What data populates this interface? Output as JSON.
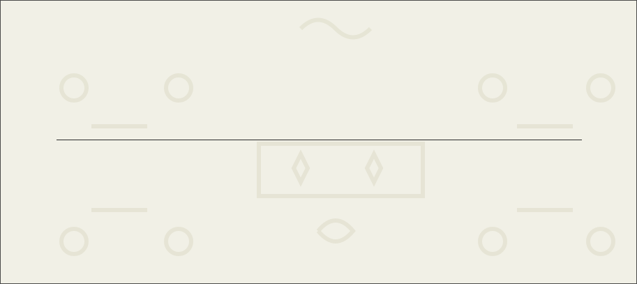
{
  "page": {
    "background_color": "#f1f0e6",
    "pattern_color": "#e6e4d4",
    "border_color": "#4a4a4a",
    "rule_color": "#2b2b2b"
  }
}
